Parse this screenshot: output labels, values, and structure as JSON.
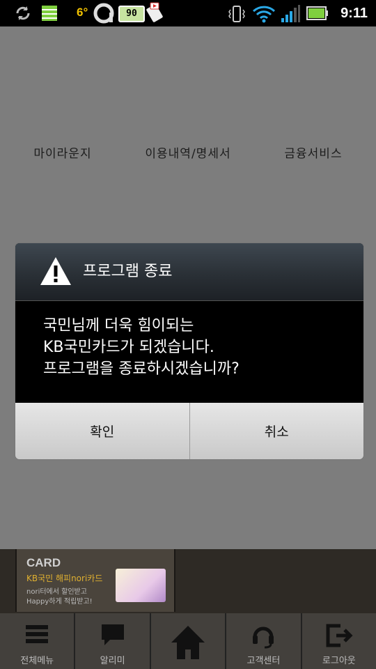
{
  "status_bar": {
    "temperature": "6°",
    "battery_badge": "90",
    "time": "9:11",
    "icons": [
      "sync-icon",
      "storage-icon",
      "a-app-icon",
      "battery-badge-icon",
      "video-phone-icon",
      "vibrate-icon",
      "wifi-icon",
      "signal-icon",
      "battery-icon"
    ]
  },
  "app": {
    "menu": [
      "마이라운지",
      "이용내역/명세서",
      "금융서비스"
    ],
    "banner": {
      "title": "CARD",
      "subtitle": "KB국민 해피nori카드",
      "line1": "nori터에서 할인받고",
      "line2": "Happy하게 적립받고!"
    },
    "bottom_nav": [
      {
        "label": "전체메뉴",
        "icon": "menu-icon"
      },
      {
        "label": "알리미",
        "icon": "message-icon"
      },
      {
        "label": "",
        "icon": "home-icon"
      },
      {
        "label": "고객센터",
        "icon": "headset-icon"
      },
      {
        "label": "로그아웃",
        "icon": "logout-icon"
      }
    ]
  },
  "dialog": {
    "title": "프로그램 종료",
    "message": "국민님께 더욱 힘이되는\nKB국민카드가 되겠습니다.\n프로그램을 종료하시겠습니까?",
    "confirm_label": "확인",
    "cancel_label": "취소"
  },
  "colors": {
    "status_bar": "#000000",
    "dim_overlay": "#7d7d7d",
    "dialog_body": "#000000",
    "banner_accent": "#e0b030"
  }
}
